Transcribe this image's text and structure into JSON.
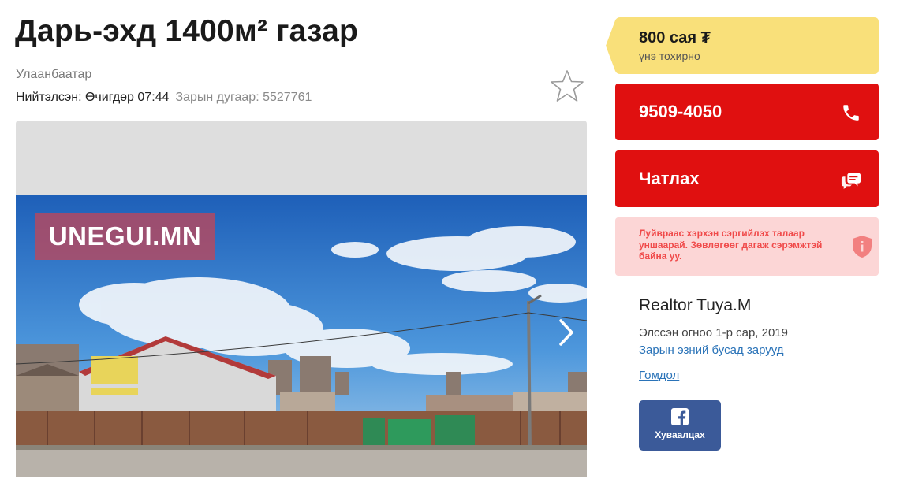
{
  "listing": {
    "title": "Дарь-эхд 1400м² газар",
    "city": "Улаанбаатар",
    "posted": "Нийтэлсэн: Өчигдөр 07:44",
    "ad_number": "Зарын дугаар: 5527761"
  },
  "gallery": {
    "watermark": "UNEGUI.MN"
  },
  "price": {
    "value": "800 сая ₮",
    "note": "үнэ тохирно"
  },
  "contact": {
    "phone": "9509-4050",
    "chat_label": "Чатлах"
  },
  "warning": {
    "text": "Луйвраас хэрхэн сэргийлэх талаар уншаарай. Зөвлөгөөг дагаж сэрэмжтэй байна уу."
  },
  "seller": {
    "name": "Realtor Tuya.M",
    "joined": "Элссэн огноо 1-р сар, 2019",
    "other_ads_link": "Зарын эзний бусад зарууд",
    "complaint_link": "Гомдол"
  },
  "share": {
    "facebook_label": "Хуваалцах"
  },
  "colors": {
    "price_bg": "#f9e07a",
    "button_red": "#e01010",
    "warning_bg": "#fcd6d6",
    "warning_text": "#f04a4a",
    "link": "#2a73b8",
    "facebook": "#3b5a99"
  }
}
